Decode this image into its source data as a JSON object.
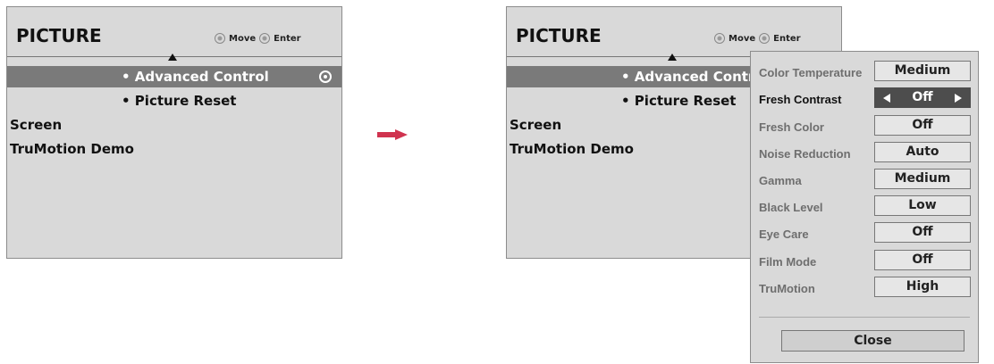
{
  "left_panel": {
    "title": "PICTURE",
    "hint_move": "Move",
    "hint_enter": "Enter",
    "items": [
      {
        "label": "• Advanced Control",
        "selected": true
      },
      {
        "label": "• Picture Reset"
      },
      {
        "label": "Screen"
      },
      {
        "label": "TruMotion Demo"
      }
    ]
  },
  "right_panel": {
    "title": "PICTURE",
    "hint_move": "Move",
    "hint_enter": "Enter",
    "items": [
      {
        "label": "• Advanced Contro",
        "selected": true
      },
      {
        "label": "• Picture Reset"
      },
      {
        "label": "Screen"
      },
      {
        "label": "TruMotion Demo"
      }
    ]
  },
  "popup": {
    "settings": [
      {
        "label": "Color Temperature",
        "value": "Medium"
      },
      {
        "label": "Fresh Contrast",
        "value": "Off",
        "active": true
      },
      {
        "label": "Fresh Color",
        "value": "Off"
      },
      {
        "label": "Noise Reduction",
        "value": "Auto"
      },
      {
        "label": "Gamma",
        "value": "Medium"
      },
      {
        "label": "Black Level",
        "value": "Low"
      },
      {
        "label": "Eye Care",
        "value": "Off"
      },
      {
        "label": "Film Mode",
        "value": "Off"
      },
      {
        "label": "TruMotion",
        "value": "High"
      }
    ],
    "close_label": "Close"
  },
  "colors": {
    "arrow": "#d0334f",
    "panel_bg": "#d9d9d9",
    "selected_bg": "#7a7a7a",
    "active_value_bg": "#4d4d4d"
  }
}
